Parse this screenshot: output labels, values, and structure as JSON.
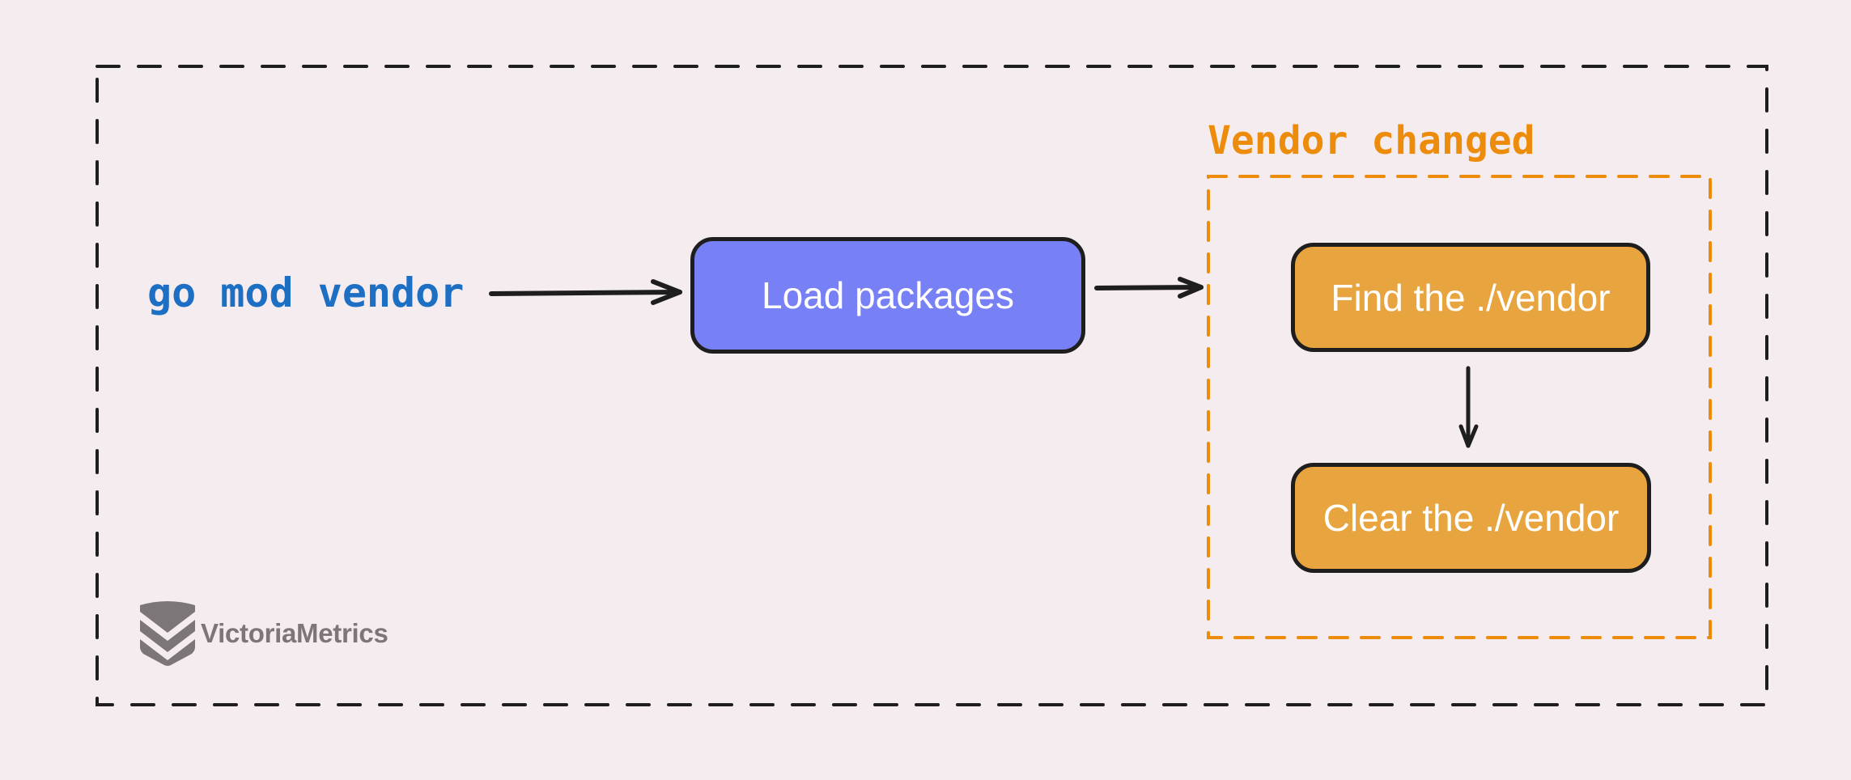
{
  "diagram": {
    "command": "go mod vendor",
    "group": {
      "label": "Vendor changed"
    },
    "nodes": [
      {
        "id": "load",
        "label": "Load packages",
        "color": "#7880f5"
      },
      {
        "id": "find",
        "label": "Find the ./vendor",
        "color": "#e8a43e"
      },
      {
        "id": "clear",
        "label": "Clear the ./vendor",
        "color": "#e8a43e"
      }
    ],
    "edges": [
      {
        "from": "command",
        "to": "load"
      },
      {
        "from": "load",
        "to": "group"
      },
      {
        "from": "find",
        "to": "clear"
      }
    ]
  },
  "brand": {
    "logo_text": "VictoriaMetrics",
    "logo_icon": "victoriametrics-logo-icon"
  },
  "colors": {
    "background": "#f5ecef",
    "command_text": "#1d6fc4",
    "group_accent": "#ed8c0a",
    "outline": "#1e1e1e",
    "logo": "#7d7679"
  }
}
